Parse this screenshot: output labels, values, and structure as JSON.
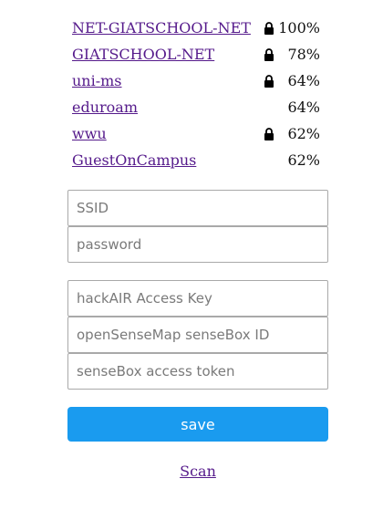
{
  "networks": [
    {
      "ssid": "NET-GIATSCHOOL-NET",
      "locked": true,
      "strength": "100%"
    },
    {
      "ssid": "GIATSCHOOL-NET",
      "locked": true,
      "strength": "78%"
    },
    {
      "ssid": "uni-ms",
      "locked": true,
      "strength": "64%"
    },
    {
      "ssid": "eduroam",
      "locked": false,
      "strength": "64%"
    },
    {
      "ssid": "wwu",
      "locked": true,
      "strength": "62%"
    },
    {
      "ssid": "GuestOnCampus",
      "locked": false,
      "strength": "62%"
    }
  ],
  "wifi_form": {
    "ssid_placeholder": "SSID",
    "password_placeholder": "password"
  },
  "api_form": {
    "hackair_placeholder": "hackAIR Access Key",
    "sensebox_id_placeholder": "openSenseMap senseBox ID",
    "sensebox_token_placeholder": "senseBox access token"
  },
  "actions": {
    "save_label": "save",
    "scan_label": "Scan"
  },
  "icons": {
    "lock": "lock-icon"
  },
  "colors": {
    "link": "#551a8b",
    "save_button": "#1a9bef"
  }
}
